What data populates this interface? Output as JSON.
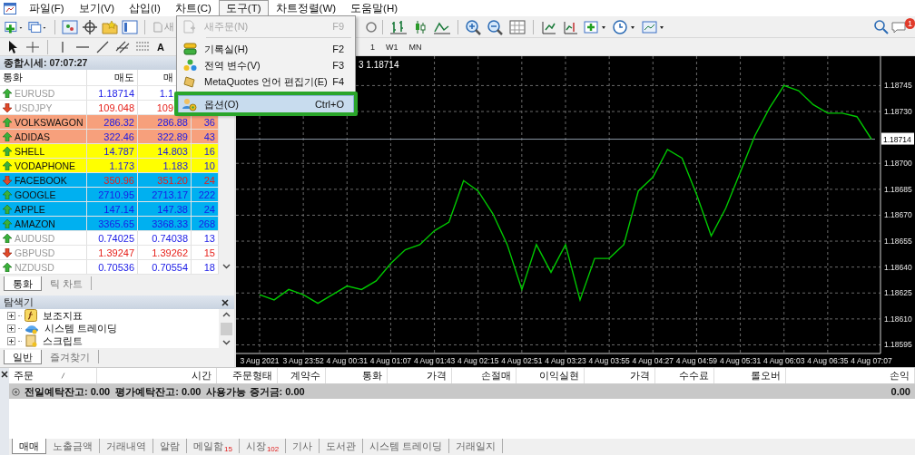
{
  "menu": [
    {
      "label": "파일(F)",
      "selected": false
    },
    {
      "label": "보기(V)",
      "selected": false
    },
    {
      "label": "삽입(I)",
      "selected": false
    },
    {
      "label": "차트(C)",
      "selected": false
    },
    {
      "label": "도구(T)",
      "selected": true
    },
    {
      "label": "차트정렬(W)",
      "selected": false
    },
    {
      "label": "도움말(H)",
      "selected": false
    }
  ],
  "toolbar": {
    "order_button": "새",
    "text_tool": "A",
    "timeframes": [
      "1",
      "W1",
      "MN"
    ],
    "notification_count": "1"
  },
  "tools_menu": {
    "items": [
      {
        "label": "새주문(N)",
        "shortcut": "F9",
        "disabled": true,
        "selected": false,
        "highlight": false,
        "separator_before": false
      },
      {
        "label": "기록실(H)",
        "shortcut": "F2",
        "disabled": false,
        "selected": false,
        "highlight": false,
        "separator_before": true
      },
      {
        "label": "전역 변수(V)",
        "shortcut": "F3",
        "disabled": false,
        "selected": false,
        "highlight": false,
        "separator_before": false
      },
      {
        "label": "MetaQuotes 언어 편집기(E)",
        "shortcut": "F4",
        "disabled": false,
        "selected": false,
        "highlight": false,
        "separator_before": false
      },
      {
        "label": "옵션(O)",
        "shortcut": "Ctrl+O",
        "disabled": false,
        "selected": true,
        "highlight": true,
        "separator_before": true
      }
    ]
  },
  "market_watch": {
    "title": "종합시세: 07:07:27",
    "columns": [
      "통화",
      "매도",
      "매"
    ],
    "rows": [
      {
        "symbol": "EURUSD",
        "rising": true,
        "color": "#ffffff",
        "dimmed": true,
        "bid": "1.18714",
        "ask": "1.1"
      },
      {
        "symbol": "USDJPY",
        "rising": false,
        "color": "#ffffff",
        "dimmed": true,
        "bid": "109.048",
        "ask": "109"
      },
      {
        "symbol": "VOLKSWAGON",
        "rising": true,
        "color": "#f7a07c",
        "dimmed": false,
        "bid": "286.32",
        "ask": "286.88",
        "spread": "36"
      },
      {
        "symbol": "ADIDAS",
        "rising": true,
        "color": "#f7a07c",
        "dimmed": false,
        "bid": "322.46",
        "ask": "322.89",
        "spread": "43"
      },
      {
        "symbol": "SHELL",
        "rising": true,
        "color": "#ffff00",
        "dimmed": false,
        "bid": "14.787",
        "ask": "14.803",
        "spread": "16"
      },
      {
        "symbol": "VODAPHONE",
        "rising": true,
        "color": "#ffff00",
        "dimmed": false,
        "bid": "1.173",
        "ask": "1.183",
        "spread": "10"
      },
      {
        "symbol": "FACEBOOK",
        "rising": false,
        "color": "#00b0f0",
        "dimmed": false,
        "bid": "350.96",
        "ask": "351.20",
        "spread": "24"
      },
      {
        "symbol": "GOOGLE",
        "rising": true,
        "color": "#00b0f0",
        "dimmed": false,
        "bid": "2710.95",
        "ask": "2713.17",
        "spread": "222"
      },
      {
        "symbol": "APPLE",
        "rising": true,
        "color": "#00b0f0",
        "dimmed": false,
        "bid": "147.14",
        "ask": "147.38",
        "spread": "24"
      },
      {
        "symbol": "AMAZON",
        "rising": true,
        "color": "#00b0f0",
        "dimmed": false,
        "bid": "3365.65",
        "ask": "3368.33",
        "spread": "268"
      },
      {
        "symbol": "AUDUSD",
        "rising": true,
        "color": "#ffffff",
        "dimmed": true,
        "bid": "0.74025",
        "ask": "0.74038",
        "spread": "13"
      },
      {
        "symbol": "GBPUSD",
        "rising": false,
        "color": "#ffffff",
        "dimmed": true,
        "bid": "1.39247",
        "ask": "1.39262",
        "spread": "15"
      },
      {
        "symbol": "NZDUSD",
        "rising": true,
        "color": "#ffffff",
        "dimmed": true,
        "bid": "0.70536",
        "ask": "0.70554",
        "spread": "18"
      }
    ],
    "tabs": [
      {
        "label": "통화",
        "selected": true
      },
      {
        "label": "틱 차트",
        "selected": false
      }
    ]
  },
  "navigator": {
    "title": "탐색기",
    "items": [
      {
        "label": "보조지표"
      },
      {
        "label": "시스템 트레이딩"
      },
      {
        "label": "스크립트"
      }
    ],
    "tabs": [
      {
        "label": "일반",
        "selected": true
      },
      {
        "label": "즐겨찾기",
        "selected": false
      }
    ]
  },
  "chart": {
    "info": "3 1.18714",
    "chart_data": {
      "type": "line",
      "grid": true,
      "ref_lines": [
        {
          "axis": "y",
          "value": 1.18714,
          "label": "1.18714"
        }
      ],
      "categories": [
        "3 Aug 2021",
        null,
        null,
        "3 Aug 23:52",
        null,
        null,
        "4 Aug 00:31",
        null,
        null,
        "4 Aug 01:07",
        null,
        null,
        "4 Aug 01:43",
        null,
        null,
        "4 Aug 02:15",
        null,
        null,
        "4 Aug 02:51",
        null,
        null,
        "4 Aug 03:23",
        null,
        null,
        "4 Aug 03:55",
        null,
        null,
        "4 Aug 04:27",
        null,
        null,
        "4 Aug 04:59",
        null,
        null,
        "4 Aug 05:31",
        null,
        null,
        "4 Aug 06:03",
        null,
        null,
        "4 Aug 06:35",
        null,
        null,
        "4 Aug 07:07"
      ],
      "series": [
        {
          "color": "#00c800",
          "values": [
            1.18624,
            1.18621,
            1.18627,
            1.18624,
            1.18619,
            1.18624,
            1.18629,
            1.18627,
            1.18632,
            1.18642,
            1.1865,
            1.18653,
            1.18661,
            1.18666,
            1.1869,
            1.18684,
            1.18671,
            1.18653,
            1.18627,
            1.18653,
            1.18637,
            1.18653,
            1.18621,
            1.18645,
            1.18645,
            1.18653,
            1.18684,
            1.18692,
            1.18708,
            1.18703,
            1.18682,
            1.18658,
            1.18674,
            1.18695,
            1.18716,
            1.18732,
            1.18745,
            1.18742,
            1.18734,
            1.18729,
            1.18729,
            1.18727,
            1.18714
          ]
        }
      ],
      "ylim": [
        1.1859,
        1.18762
      ],
      "yticks": [
        {
          "value": 1.18595,
          "label": "1.18595"
        },
        {
          "value": 1.1861,
          "label": "1.18610"
        },
        {
          "value": 1.18625,
          "label": "1.18625"
        },
        {
          "value": 1.1864,
          "label": "1.18640"
        },
        {
          "value": 1.18655,
          "label": "1.18655"
        },
        {
          "value": 1.1867,
          "label": "1.18670"
        },
        {
          "value": 1.18685,
          "label": "1.18685"
        },
        {
          "value": 1.187,
          "label": "1.18700"
        },
        {
          "value": 1.1873,
          "label": "1.18730"
        },
        {
          "value": 1.18745,
          "label": "1.18745"
        }
      ]
    }
  },
  "toolbox": {
    "columns": [
      "주문",
      "시간",
      "주문형태",
      "계약수",
      "통화",
      "가격",
      "손절매",
      "이익실현",
      "가격",
      "수수료",
      "롤오버",
      "손익"
    ],
    "summary": "전일예탁잔고: 0.00  평가예탁잔고: 0.00  사용가능 증거금: 0.00",
    "summary_total": "0.00",
    "tabs": [
      {
        "label": "매매",
        "selected": true
      },
      {
        "label": "노출금액",
        "selected": false
      },
      {
        "label": "거래내역",
        "selected": false
      },
      {
        "label": "알람",
        "selected": false
      },
      {
        "label": "메일함",
        "count": "15",
        "selected": false
      },
      {
        "label": "시장",
        "count": "102",
        "selected": false
      },
      {
        "label": "기사",
        "selected": false
      },
      {
        "label": "도서관",
        "selected": false
      },
      {
        "label": "시스템 트레이딩",
        "selected": false
      },
      {
        "label": "거래일지",
        "selected": false
      }
    ]
  }
}
